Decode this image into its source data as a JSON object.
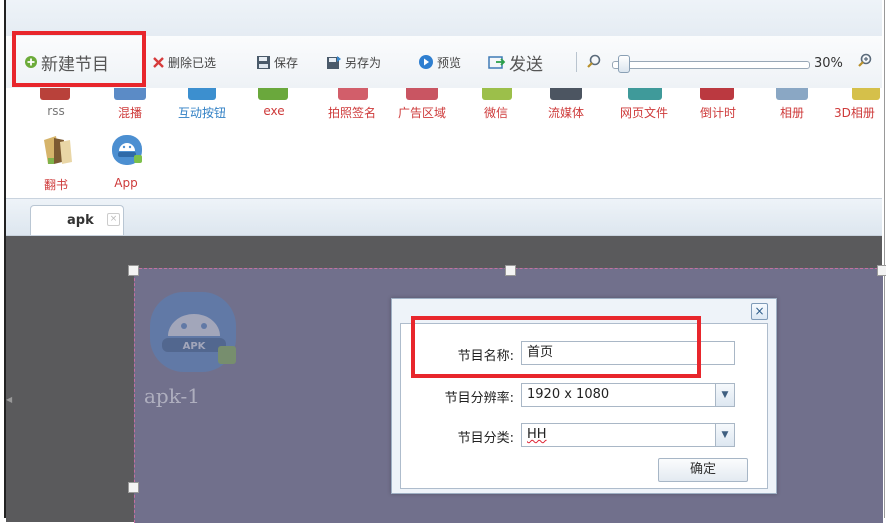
{
  "toolbar": {
    "new_program": "新建节目",
    "delete_selected": "删除已选",
    "save": "保存",
    "save_as": "另存为",
    "preview": "预览",
    "send": "发送",
    "zoom_value": "30%",
    "zoom_level": 0.3
  },
  "palette": {
    "row1": [
      "rss",
      "混播",
      "互动按钮",
      "exe",
      "拍照签名",
      "广告区域",
      "微信",
      "流媒体",
      "网页文件",
      "倒计时",
      "相册",
      "3D相册"
    ],
    "row2": [
      "翻书",
      "App"
    ]
  },
  "tabs": [
    {
      "label": "apk",
      "close": "×"
    }
  ],
  "canvas": {
    "element_label": "apk-1",
    "icon_text": "APK"
  },
  "dialog": {
    "close": "×",
    "name_label": "节目名称:",
    "name_value": "首页",
    "resolution_label": "节目分辨率:",
    "resolution_value": "1920 x 1080",
    "category_label": "节目分类:",
    "category_value": "HH",
    "ok": "确定"
  },
  "colors": {
    "highlight": "#e8262c",
    "palette_label": "#ce3a3a",
    "slide": "#71708c",
    "canvas": "#5a5a5c"
  }
}
